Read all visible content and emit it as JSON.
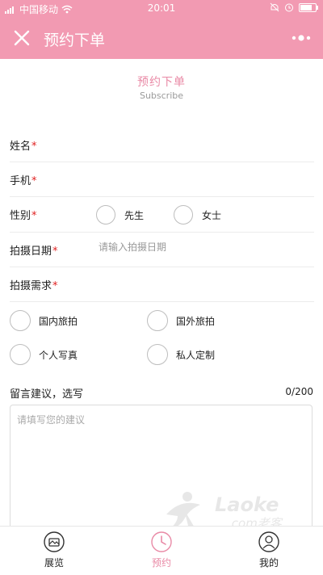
{
  "status_bar": {
    "carrier": "中国移动",
    "time": "20:01"
  },
  "nav": {
    "title": "预约下单"
  },
  "header": {
    "title": "预约下单",
    "subtitle": "Subscribe"
  },
  "form": {
    "name_label": "姓名",
    "phone_label": "手机",
    "gender_label": "性别",
    "gender_options": [
      "先生",
      "女士"
    ],
    "date_label": "拍摄日期",
    "date_placeholder": "请输入拍摄日期",
    "needs_label": "拍摄需求",
    "needs_options": [
      "国内旅拍",
      "国外旅拍",
      "个人写真",
      "私人定制"
    ],
    "required_mark": "*",
    "notes_label": "留言建议，选写",
    "notes_counter": "0/200",
    "notes_placeholder": "请填写您的建议"
  },
  "watermark": {
    "brand": "Laoke",
    "sub": ".com老客"
  },
  "tabbar": {
    "items": [
      {
        "label": "展览",
        "icon": "gallery-icon"
      },
      {
        "label": "预约",
        "icon": "clock-icon"
      },
      {
        "label": "我的",
        "icon": "user-icon"
      }
    ],
    "active_index": 1
  },
  "colors": {
    "primary": "#f29ab2",
    "accent_text": "#e98aa6",
    "required": "#e02020"
  }
}
